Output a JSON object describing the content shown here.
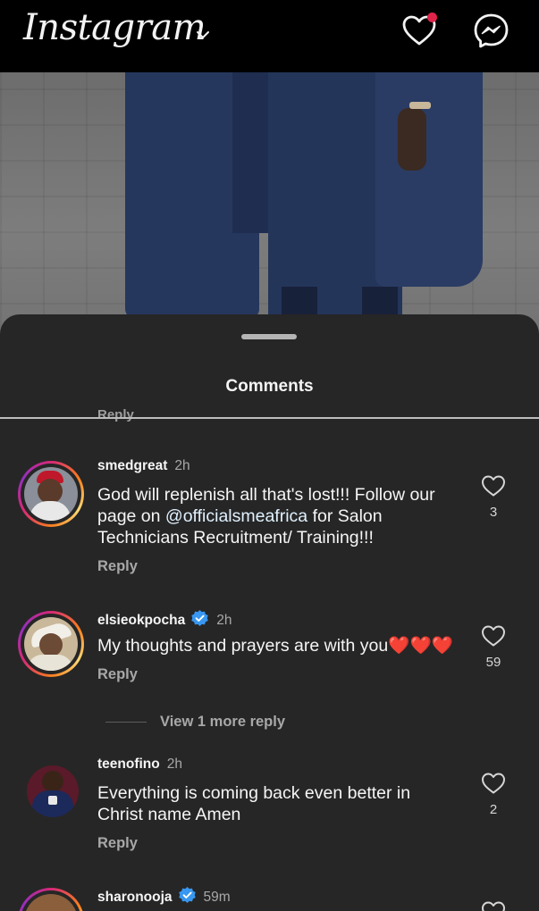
{
  "app": {
    "logo": "Instagram",
    "icons": [
      "chevron-down-icon",
      "heart-icon",
      "messenger-icon"
    ],
    "notification_dot_color": "#e0244a"
  },
  "post": {
    "image": "photo-of-two-people-in-navy-agbada-on-paved-ground"
  },
  "sheet": {
    "title": "Comments",
    "cut_off_reply": "Reply"
  },
  "comments": [
    {
      "username": "smedgreat",
      "time": "2h",
      "verified": false,
      "text_before": "God will replenish all that's lost!!! Follow our page on ",
      "mention": "@officialsmeafrica",
      "text_after": " for Salon Technicians Recruitment/ Training!!!",
      "likes": "3",
      "reply_label": "Reply"
    },
    {
      "username": "elsieokpocha",
      "time": "2h",
      "verified": true,
      "text": "My thoughts and prayers are with you❤️❤️❤️",
      "likes": "59",
      "reply_label": "Reply"
    },
    {
      "username": "teenofino",
      "time": "2h",
      "verified": false,
      "text": "Everything is coming back even better in Christ name Amen",
      "likes": "2",
      "reply_label": "Reply"
    },
    {
      "username": "sharonooja",
      "time": "59m",
      "verified": true
    }
  ],
  "view_more_replies": "View 1 more reply",
  "colors": {
    "background": "#262626",
    "topbar": "#000000",
    "verified": "#3897f0",
    "secondary_text": "#a8a8a8"
  }
}
